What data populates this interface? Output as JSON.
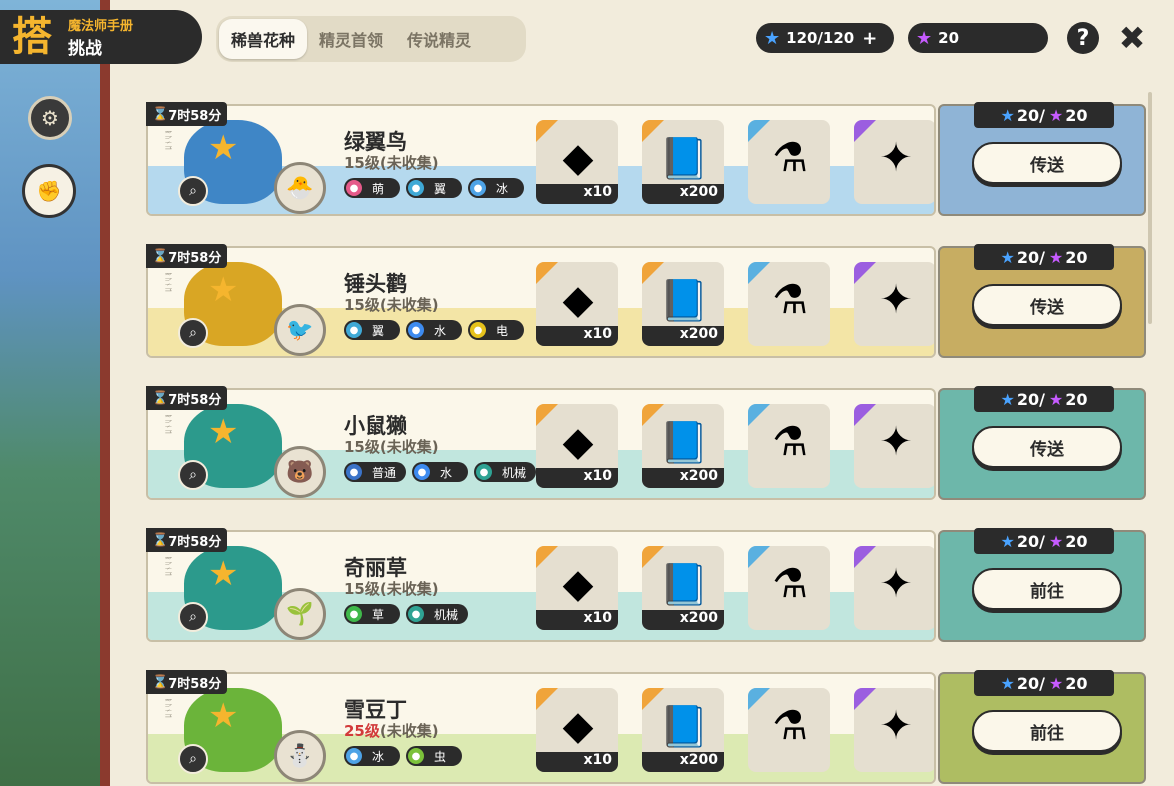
{
  "header": {
    "logo_sub": "魔法师手册",
    "logo_main": "挑战",
    "logo_mark": "搭"
  },
  "tabs": [
    {
      "label": "稀兽花种",
      "active": true
    },
    {
      "label": "精灵首领",
      "active": false
    },
    {
      "label": "传说精灵",
      "active": false
    }
  ],
  "currency": {
    "energy": "120/120",
    "gems": "20"
  },
  "rows": [
    {
      "timer": "7时58分",
      "name": "绿翼鸟",
      "level": "15级",
      "level_red": false,
      "status": "(未收集)",
      "types": [
        {
          "label": "萌",
          "color": "#e55a8a"
        },
        {
          "label": "翼",
          "color": "#3fa9d6"
        },
        {
          "label": "冰",
          "color": "#4ea3e6"
        }
      ],
      "rewards": [
        {
          "qty": "x10",
          "icon": "crystal-icon",
          "corner": "orange"
        },
        {
          "qty": "x200",
          "icon": "book-icon",
          "corner": "orange"
        },
        {
          "qty": "",
          "icon": "potion-icon",
          "corner": "blue"
        },
        {
          "qty": "",
          "icon": "purple-orb-icon",
          "corner": "purple"
        }
      ],
      "cost_blue": "20/",
      "cost_purple": "20",
      "action": "传送",
      "band_color": "#a8d3ee",
      "side_color": "#8fb4d6",
      "blob_color": "#3f86c6",
      "pet": "green-pet"
    },
    {
      "timer": "7时58分",
      "name": "锤头鹳",
      "level": "15级",
      "level_red": false,
      "status": "(未收集)",
      "types": [
        {
          "label": "翼",
          "color": "#3fa9d6"
        },
        {
          "label": "水",
          "color": "#3d8bf0"
        },
        {
          "label": "电",
          "color": "#e6c21c"
        }
      ],
      "rewards": [
        {
          "qty": "x10",
          "icon": "crystal-icon",
          "corner": "orange"
        },
        {
          "qty": "x200",
          "icon": "book-icon",
          "corner": "orange"
        },
        {
          "qty": "",
          "icon": "potion-icon",
          "corner": "blue"
        },
        {
          "qty": "",
          "icon": "purple-orb-icon",
          "corner": "purple"
        }
      ],
      "cost_blue": "20/",
      "cost_purple": "20",
      "action": "传送",
      "band_color": "#f1e29a",
      "side_color": "#c7ad62",
      "blob_color": "#d9a624",
      "pet": "bird-pet"
    },
    {
      "timer": "7时58分",
      "name": "小鼠獭",
      "level": "15级",
      "level_red": false,
      "status": "(未收集)",
      "types": [
        {
          "label": "普通",
          "color": "#3b73c8"
        },
        {
          "label": "水",
          "color": "#3d8bf0"
        },
        {
          "label": "机械",
          "color": "#2fa394"
        }
      ],
      "rewards": [
        {
          "qty": "x10",
          "icon": "crystal-icon",
          "corner": "orange"
        },
        {
          "qty": "x200",
          "icon": "book-icon",
          "corner": "orange"
        },
        {
          "qty": "",
          "icon": "potion-icon",
          "corner": "blue"
        },
        {
          "qty": "",
          "icon": "purple-orb-icon",
          "corner": "purple"
        }
      ],
      "cost_blue": "20/",
      "cost_purple": "20",
      "action": "传送",
      "band_color": "#b6e3dc",
      "side_color": "#6db7aa",
      "blob_color": "#2c9a8c",
      "pet": "otter-pet"
    },
    {
      "timer": "7时58分",
      "name": "奇丽草",
      "level": "15级",
      "level_red": false,
      "status": "(未收集)",
      "types": [
        {
          "label": "草",
          "color": "#3fb84a"
        },
        {
          "label": "机械",
          "color": "#2fa394"
        }
      ],
      "rewards": [
        {
          "qty": "x10",
          "icon": "crystal-icon",
          "corner": "orange"
        },
        {
          "qty": "x200",
          "icon": "book-icon",
          "corner": "orange"
        },
        {
          "qty": "",
          "icon": "potion-icon",
          "corner": "blue"
        },
        {
          "qty": "",
          "icon": "purple-orb-icon",
          "corner": "purple"
        }
      ],
      "cost_blue": "20/",
      "cost_purple": "20",
      "action": "前往",
      "band_color": "#b6e3dc",
      "side_color": "#6db7aa",
      "blob_color": "#2c9a8c",
      "pet": "leaf-pet"
    },
    {
      "timer": "7时58分",
      "name": "雪豆丁",
      "level": "25级",
      "level_red": true,
      "status": "(未收集)",
      "types": [
        {
          "label": "冰",
          "color": "#4ea3e6"
        },
        {
          "label": "虫",
          "color": "#7cc23a"
        }
      ],
      "rewards": [
        {
          "qty": "x10",
          "icon": "crystal-icon",
          "corner": "orange"
        },
        {
          "qty": "x200",
          "icon": "book-icon",
          "corner": "orange"
        },
        {
          "qty": "",
          "icon": "potion-icon",
          "corner": "blue"
        },
        {
          "qty": "",
          "icon": "purple-orb-icon",
          "corner": "purple"
        }
      ],
      "cost_blue": "20/",
      "cost_purple": "20",
      "action": "前往",
      "band_color": "#d6e7a8",
      "side_color": "#aebd62",
      "blob_color": "#6bb43a",
      "pet": "snow-pet"
    }
  ]
}
